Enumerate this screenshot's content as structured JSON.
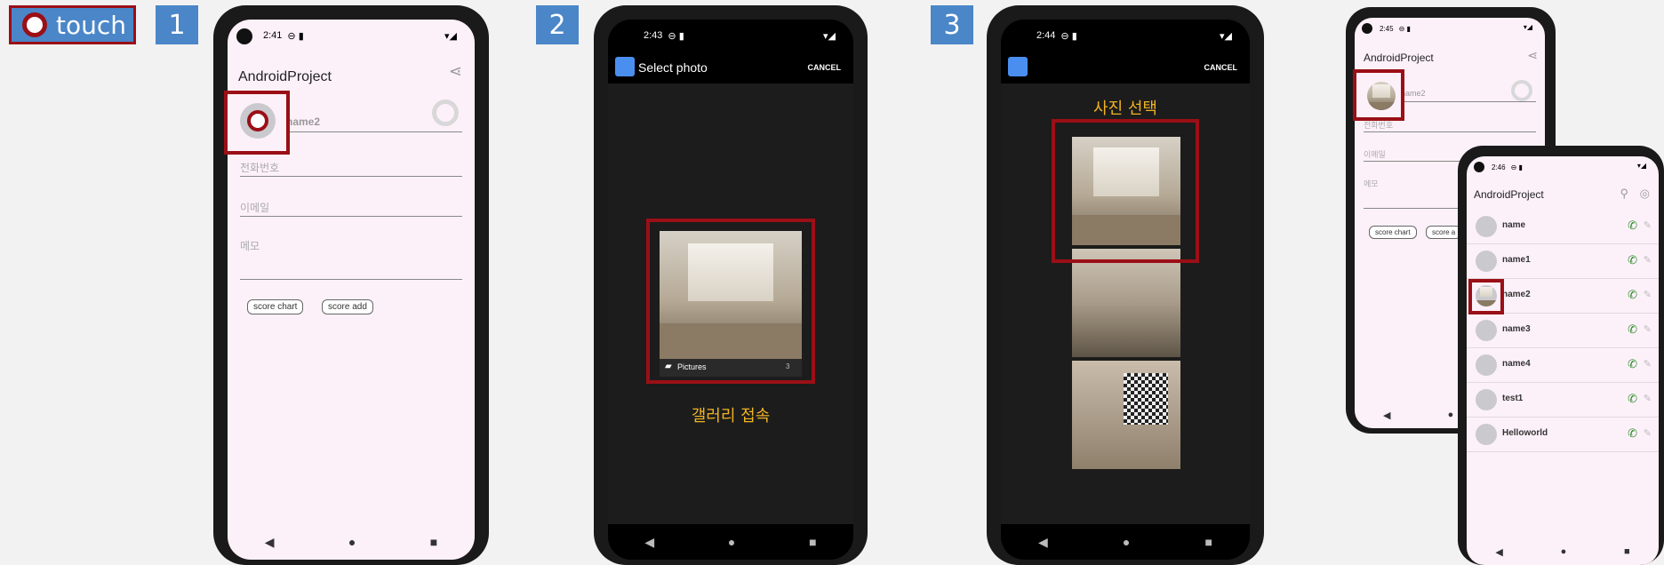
{
  "legend": {
    "label": "touch"
  },
  "steps": [
    "1",
    "2",
    "3"
  ],
  "screen1": {
    "time": "2:41",
    "app_title": "AndroidProject",
    "name_value": "name2",
    "phone_placeholder": "전화번호",
    "email_placeholder": "이메일",
    "memo_placeholder": "메모",
    "score_chart": "score chart",
    "score_add": "score add"
  },
  "screen2": {
    "time": "2:43",
    "title": "Select photo",
    "cancel": "CANCEL",
    "folder": "Pictures",
    "folder_count": "3",
    "caption": "갤러리 접속"
  },
  "screen3": {
    "time": "2:44",
    "cancel": "CANCEL",
    "caption": "사진 선택"
  },
  "screen4a": {
    "time": "2:45",
    "app_title": "AndroidProject",
    "name_value": "name2",
    "phone_placeholder": "전화번호",
    "email_placeholder": "이메일",
    "memo_placeholder": "메모",
    "score_chart": "score chart",
    "score_add": "score a"
  },
  "screen4b": {
    "time": "2:46",
    "app_title": "AndroidProject",
    "contacts": [
      "name",
      "name1",
      "name2",
      "name3",
      "name4",
      "test1",
      "Helloworld"
    ]
  },
  "colors": {
    "accent_red": "#9b0f16",
    "step_blue": "#4a86c8",
    "caption_yellow": "#f0b323"
  }
}
